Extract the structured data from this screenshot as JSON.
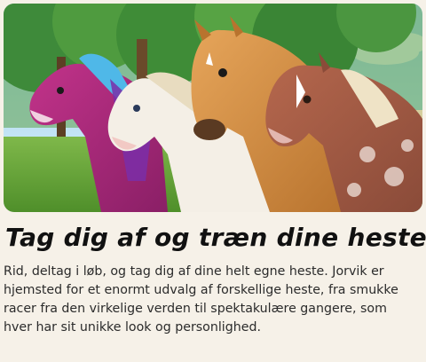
{
  "article": {
    "title": "Tag dig af og træn dine heste",
    "description": "Rid, deltag i løb, og tag dig af dine helt egne heste. Jorvik er hjemsted for et enormt udvalg af forskellige heste, fra smukke racer fra den virkelige verden til spektakulære gangere, som hver har sit unikke look og personlighed."
  },
  "colors": {
    "background": "#f6f1e8",
    "title": "#111111",
    "text": "#2b2b2b"
  }
}
